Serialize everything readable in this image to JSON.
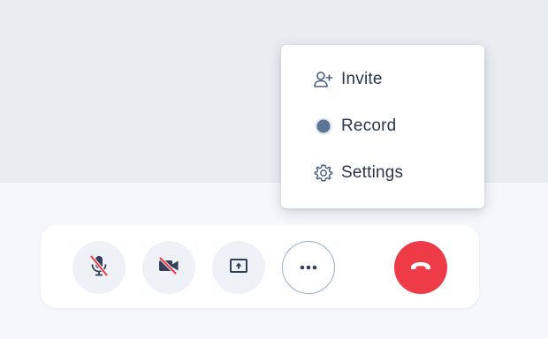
{
  "menu": {
    "items": [
      {
        "icon": "add-user-icon",
        "label": "Invite"
      },
      {
        "icon": "record-icon",
        "label": "Record"
      },
      {
        "icon": "gear-icon",
        "label": "Settings"
      }
    ]
  },
  "controls": {
    "buttons": [
      {
        "name": "mute-microphone-button",
        "icon": "microphone-off-icon",
        "state": "off"
      },
      {
        "name": "toggle-camera-button",
        "icon": "camera-off-icon",
        "state": "off"
      },
      {
        "name": "share-screen-button",
        "icon": "screen-share-icon"
      },
      {
        "name": "more-options-button",
        "icon": "more-dots-icon",
        "state": "open"
      },
      {
        "name": "hang-up-button",
        "icon": "phone-hangup-icon"
      }
    ]
  },
  "colors": {
    "accent_red": "#ef3a48",
    "icon_slate": "#2b3548",
    "record_dot": "#5d7596",
    "slash_red": "#ef3a48"
  }
}
